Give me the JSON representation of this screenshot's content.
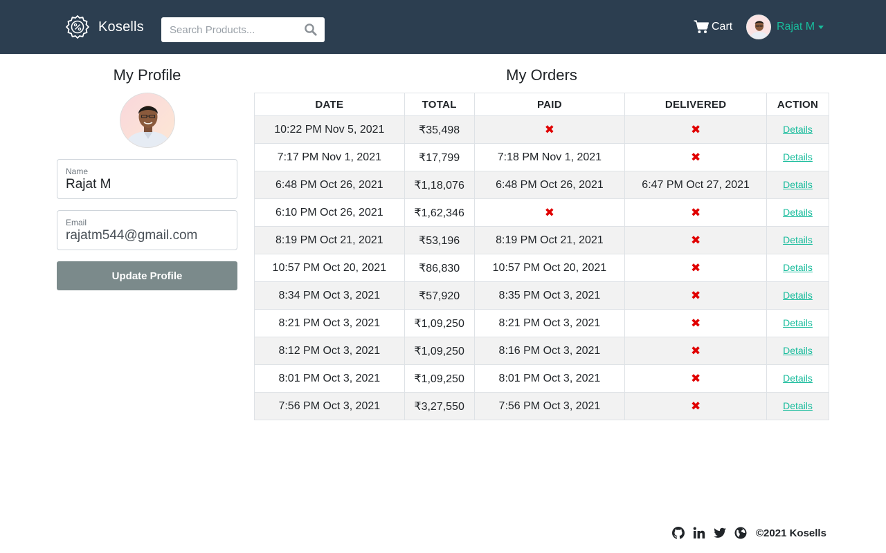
{
  "navbar": {
    "brand": "Kosells",
    "search_placeholder": "Search Products...",
    "cart_label": "Cart",
    "user_name": "Rajat M"
  },
  "profile": {
    "title": "My Profile",
    "name_label": "Name",
    "name_value": "Rajat M",
    "email_label": "Email",
    "email_value": "rajatm544@gmail.com",
    "update_button": "Update Profile"
  },
  "orders": {
    "title": "My Orders",
    "headers": [
      "DATE",
      "TOTAL",
      "PAID",
      "DELIVERED",
      "ACTION"
    ],
    "rows": [
      {
        "date": "10:22 PM Nov 5, 2021",
        "total": "₹35,498",
        "paid": "✖",
        "delivered": "✖",
        "action": "Details"
      },
      {
        "date": "7:17 PM Nov 1, 2021",
        "total": "₹17,799",
        "paid": "7:18 PM Nov 1, 2021",
        "delivered": "✖",
        "action": "Details"
      },
      {
        "date": "6:48 PM Oct 26, 2021",
        "total": "₹1,18,076",
        "paid": "6:48 PM Oct 26, 2021",
        "delivered": "6:47 PM Oct 27, 2021",
        "action": "Details"
      },
      {
        "date": "6:10 PM Oct 26, 2021",
        "total": "₹1,62,346",
        "paid": "✖",
        "delivered": "✖",
        "action": "Details"
      },
      {
        "date": "8:19 PM Oct 21, 2021",
        "total": "₹53,196",
        "paid": "8:19 PM Oct 21, 2021",
        "delivered": "✖",
        "action": "Details"
      },
      {
        "date": "10:57 PM Oct 20, 2021",
        "total": "₹86,830",
        "paid": "10:57 PM Oct 20, 2021",
        "delivered": "✖",
        "action": "Details"
      },
      {
        "date": "8:34 PM Oct 3, 2021",
        "total": "₹57,920",
        "paid": "8:35 PM Oct 3, 2021",
        "delivered": "✖",
        "action": "Details"
      },
      {
        "date": "8:21 PM Oct 3, 2021",
        "total": "₹1,09,250",
        "paid": "8:21 PM Oct 3, 2021",
        "delivered": "✖",
        "action": "Details"
      },
      {
        "date": "8:12 PM Oct 3, 2021",
        "total": "₹1,09,250",
        "paid": "8:16 PM Oct 3, 2021",
        "delivered": "✖",
        "action": "Details"
      },
      {
        "date": "8:01 PM Oct 3, 2021",
        "total": "₹1,09,250",
        "paid": "8:01 PM Oct 3, 2021",
        "delivered": "✖",
        "action": "Details"
      },
      {
        "date": "7:56 PM Oct 3, 2021",
        "total": "₹3,27,550",
        "paid": "7:56 PM Oct 3, 2021",
        "delivered": "✖",
        "action": "Details"
      }
    ]
  },
  "footer": {
    "icons": [
      "github-icon",
      "linkedin-icon",
      "twitter-icon",
      "globe-icon"
    ],
    "copyright": "©2021 Kosells"
  },
  "colors": {
    "navbar": "#2c3e50",
    "accent": "#18bc9c",
    "button": "#7b8a8b",
    "cross": "#e00000",
    "striped_row": "#f2f2f2"
  }
}
